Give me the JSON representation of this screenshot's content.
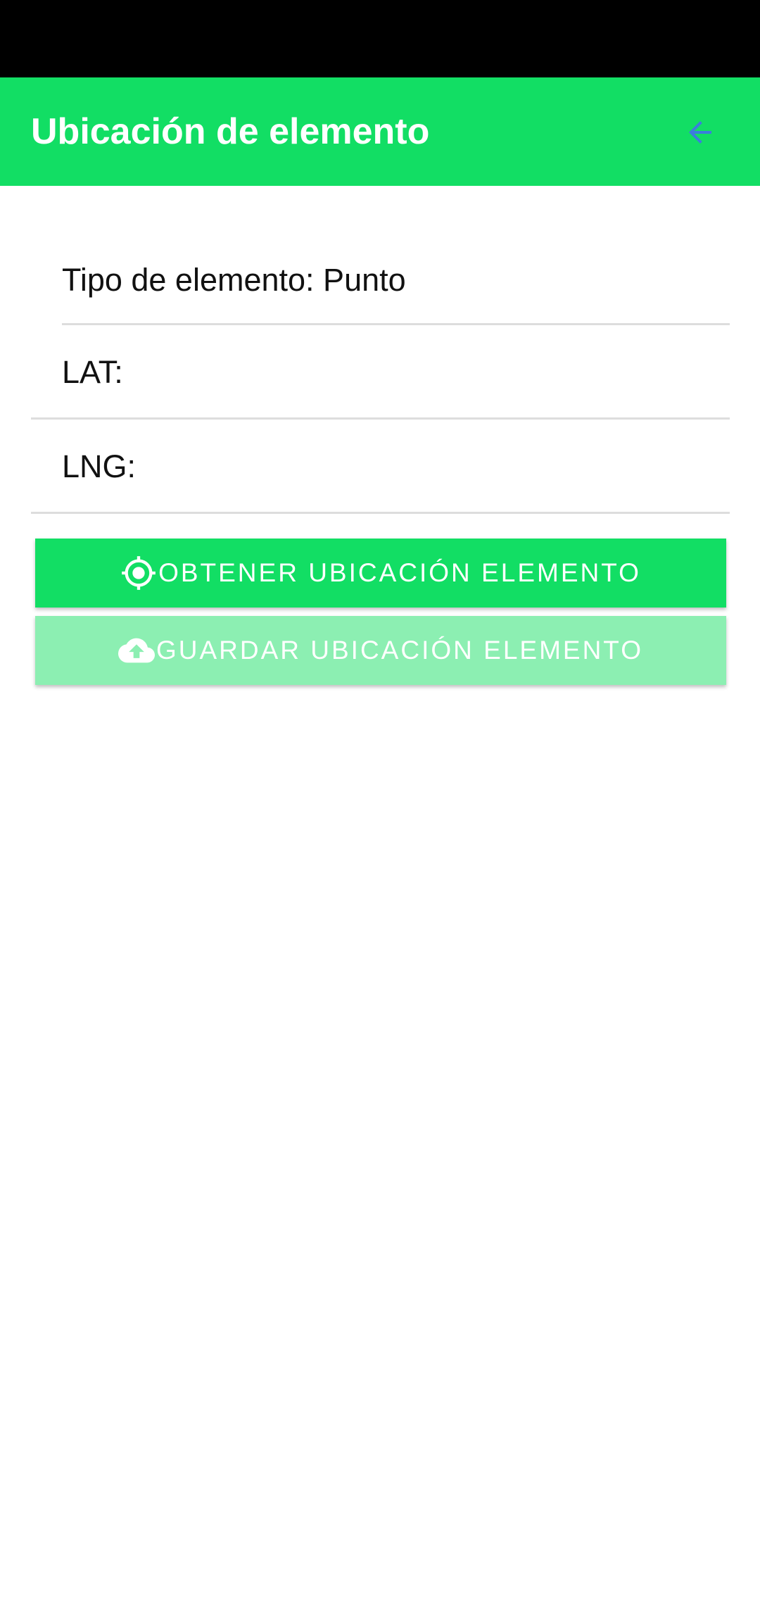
{
  "app_bar": {
    "title": "Ubicación de elemento",
    "back_icon": "arrow-back-icon",
    "back_icon_color": "#3b7ddd"
  },
  "fields": {
    "element_type": "Tipo de elemento: Punto",
    "lat": "LAT:",
    "lng": "LNG:"
  },
  "buttons": {
    "get_location": {
      "label": "OBTENER UBICACIÓN ELEMENTO",
      "icon": "gps-target-icon"
    },
    "save_location": {
      "label": "GUARDAR UBICACIÓN ELEMENTO",
      "icon": "cloud-upload-icon",
      "disabled": true
    }
  },
  "colors": {
    "primary": "#12de64",
    "primary_disabled": "#8cefb2",
    "status_bar": "#000000"
  }
}
